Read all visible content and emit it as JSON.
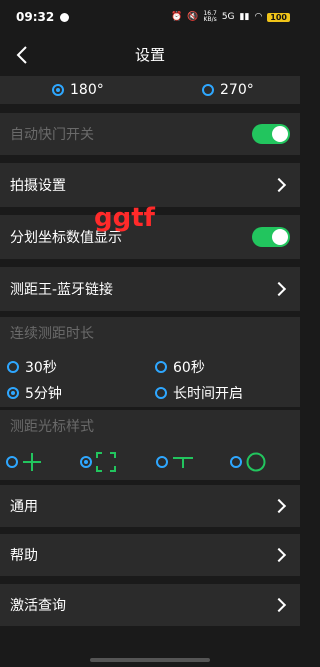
{
  "status": {
    "time": "09:32",
    "network": "5G",
    "speed_top": "16.7",
    "speed_bottom": "KB/s",
    "battery": "100"
  },
  "nav": {
    "title": "设置"
  },
  "rotation": {
    "options": [
      "180°",
      "270°"
    ],
    "selected": "180°"
  },
  "auto_shutter_label": "自动快门开关",
  "shoot_settings_label": "拍摄设置",
  "reticle_values_label": "分划坐标数值显示",
  "watermark_text": "ggtf",
  "bluetooth_label": "测距王-蓝牙链接",
  "continuous": {
    "header": "连续测距时长",
    "options": [
      "30秒",
      "60秒",
      "5分钟",
      "长时间开启"
    ],
    "selected": "5分钟"
  },
  "cursor_style": {
    "header": "测距光标样式",
    "options": [
      "cross-cursor-icon",
      "bracket-cursor-icon",
      "t-cursor-icon",
      "circle-cursor-icon"
    ],
    "selected": "bracket-cursor-icon",
    "accent": "#2ea7ff",
    "line_color": "#22c55e"
  },
  "general_label": "通用",
  "help_label": "帮助",
  "activation_label": "激活查询",
  "toggle_color": "#22c55e"
}
